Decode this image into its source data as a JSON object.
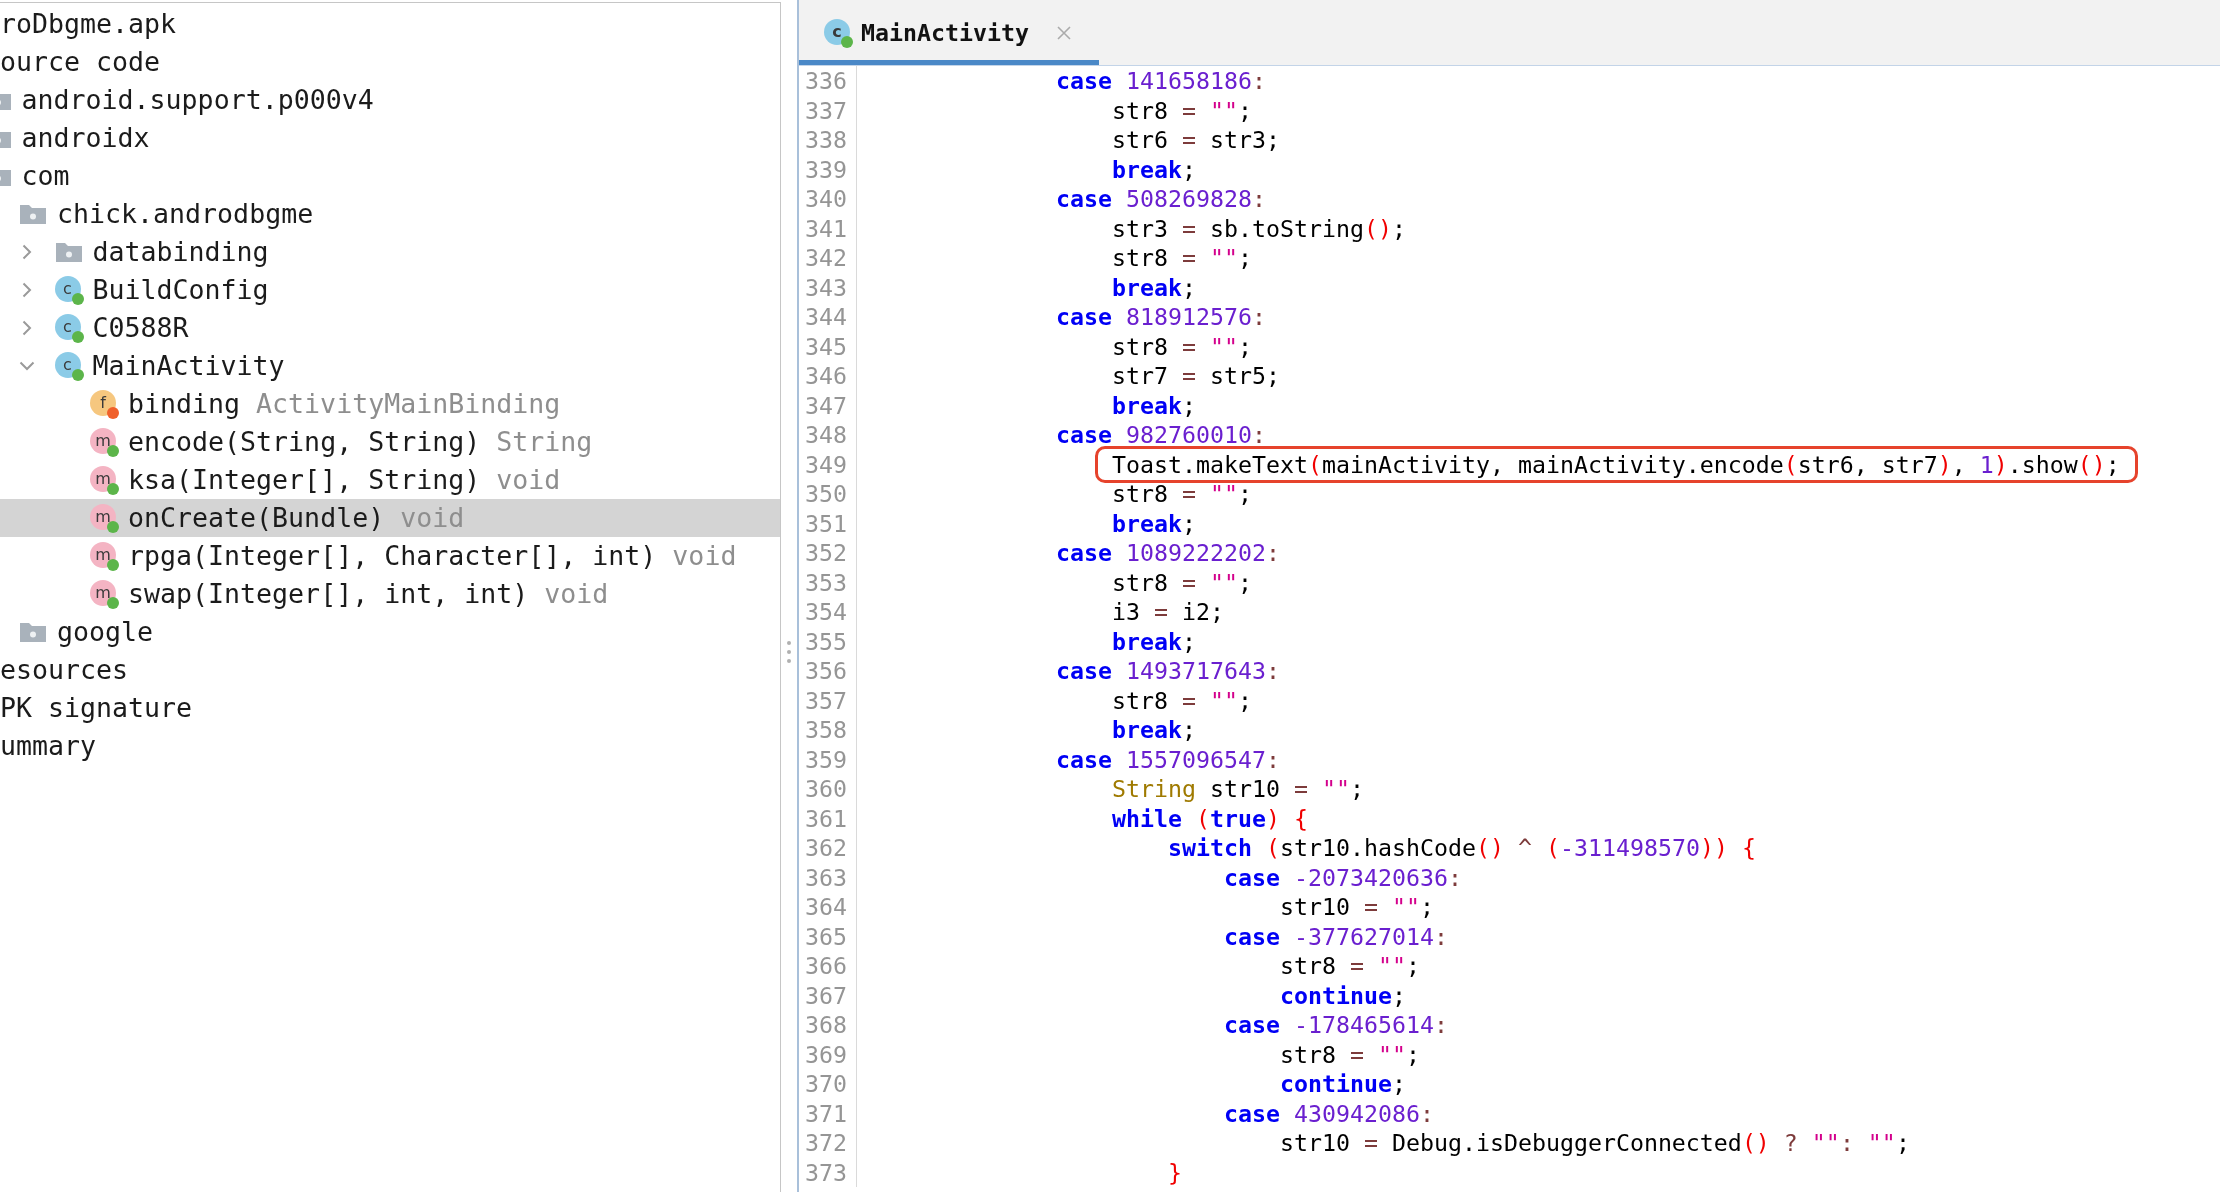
{
  "project_tree": {
    "items": [
      {
        "label": "roDbgme.apk",
        "selected": false,
        "children": [
          {
            "label": "ource code",
            "selected": false,
            "children": [
              {
                "label": "android.support.p000v4",
                "kind": "package",
                "selected": false
              },
              {
                "label": "androidx",
                "kind": "package",
                "selected": false
              },
              {
                "label": "com",
                "kind": "package",
                "selected": false,
                "children": [
                  {
                    "label": "chick.androdbgme",
                    "kind": "package",
                    "selected": false,
                    "children": [
                      {
                        "label": "databinding",
                        "kind": "package",
                        "expanded": false,
                        "selected": false
                      },
                      {
                        "label": "BuildConfig",
                        "kind": "class",
                        "icon_letter": "c",
                        "color": "#5cb54a",
                        "expanded": false,
                        "selected": false
                      },
                      {
                        "label": "C0588R",
                        "kind": "class",
                        "icon_letter": "c",
                        "color": "#5cb54a",
                        "expanded": false,
                        "selected": false
                      },
                      {
                        "label": "MainActivity",
                        "kind": "class",
                        "icon_letter": "c",
                        "color": "#5cb54a",
                        "expanded": true,
                        "selected": false,
                        "children": [
                          {
                            "label": "binding",
                            "type": "ActivityMainBinding",
                            "kind": "field",
                            "icon_letter": "f",
                            "color": "#f0602b",
                            "selected": false
                          },
                          {
                            "label": "encode(String, String)",
                            "type": "String",
                            "kind": "method",
                            "icon_letter": "m",
                            "color": "#5cb54a",
                            "selected": false
                          },
                          {
                            "label": "ksa(Integer[], String)",
                            "type": "void",
                            "kind": "method",
                            "icon_letter": "m",
                            "color": "#5cb54a",
                            "selected": false
                          },
                          {
                            "label": "onCreate(Bundle)",
                            "type": "void",
                            "kind": "method",
                            "icon_letter": "m",
                            "color": "#5cb54a",
                            "selected": true
                          },
                          {
                            "label": "rpga(Integer[], Character[], int)",
                            "type": "void",
                            "kind": "method",
                            "icon_letter": "m",
                            "color": "#5cb54a",
                            "selected": false
                          },
                          {
                            "label": "swap(Integer[], int, int)",
                            "type": "void",
                            "kind": "method",
                            "icon_letter": "m",
                            "color": "#5cb54a",
                            "selected": false
                          }
                        ]
                      }
                    ]
                  },
                  {
                    "label": "google",
                    "kind": "package",
                    "selected": false
                  }
                ]
              }
            ]
          },
          {
            "label": "esources",
            "selected": false
          },
          {
            "label": "PK signature",
            "selected": false
          },
          {
            "label": "ummary",
            "selected": false
          }
        ]
      }
    ]
  },
  "tabs": [
    {
      "label": "MainActivity",
      "icon_letter": "c",
      "color": "#5cb54a",
      "selected": true
    }
  ],
  "code": {
    "lines": [
      {
        "number": "336",
        "tokens": [
          {
            "kind": "keyword",
            "text": "            case"
          },
          {
            "kind": "number",
            "text": " 141658186"
          },
          {
            "kind": "operator",
            "text": ":"
          }
        ]
      },
      {
        "number": "337",
        "tokens": [
          {
            "kind": "plain",
            "text": "                str8 "
          },
          {
            "kind": "operator",
            "text": "="
          },
          {
            "kind": "string",
            "text": " \"\""
          },
          {
            "kind": "plain",
            "text": ";"
          }
        ]
      },
      {
        "number": "338",
        "tokens": [
          {
            "kind": "plain",
            "text": "                str6 "
          },
          {
            "kind": "operator",
            "text": "="
          },
          {
            "kind": "plain",
            "text": " str3;"
          }
        ]
      },
      {
        "number": "339",
        "tokens": [
          {
            "kind": "keyword",
            "text": "                break"
          },
          {
            "kind": "plain",
            "text": ";"
          }
        ]
      },
      {
        "number": "340",
        "tokens": [
          {
            "kind": "keyword",
            "text": "            case"
          },
          {
            "kind": "number",
            "text": " 508269828"
          },
          {
            "kind": "operator",
            "text": ":"
          }
        ]
      },
      {
        "number": "341",
        "tokens": [
          {
            "kind": "plain",
            "text": "                str3 "
          },
          {
            "kind": "operator",
            "text": "="
          },
          {
            "kind": "plain",
            "text": " sb.toString"
          },
          {
            "kind": "bracket",
            "text": "()"
          },
          {
            "kind": "plain",
            "text": ";"
          }
        ]
      },
      {
        "number": "342",
        "tokens": [
          {
            "kind": "plain",
            "text": "                str8 "
          },
          {
            "kind": "operator",
            "text": "="
          },
          {
            "kind": "string",
            "text": " \"\""
          },
          {
            "kind": "plain",
            "text": ";"
          }
        ]
      },
      {
        "number": "343",
        "tokens": [
          {
            "kind": "keyword",
            "text": "                break"
          },
          {
            "kind": "plain",
            "text": ";"
          }
        ]
      },
      {
        "number": "344",
        "tokens": [
          {
            "kind": "keyword",
            "text": "            case"
          },
          {
            "kind": "number",
            "text": " 818912576"
          },
          {
            "kind": "operator",
            "text": ":"
          }
        ]
      },
      {
        "number": "345",
        "tokens": [
          {
            "kind": "plain",
            "text": "                str8 "
          },
          {
            "kind": "operator",
            "text": "="
          },
          {
            "kind": "string",
            "text": " \"\""
          },
          {
            "kind": "plain",
            "text": ";"
          }
        ]
      },
      {
        "number": "346",
        "tokens": [
          {
            "kind": "plain",
            "text": "                str7 "
          },
          {
            "kind": "operator",
            "text": "="
          },
          {
            "kind": "plain",
            "text": " str5;"
          }
        ]
      },
      {
        "number": "347",
        "tokens": [
          {
            "kind": "keyword",
            "text": "                break"
          },
          {
            "kind": "plain",
            "text": ";"
          }
        ]
      },
      {
        "number": "348",
        "tokens": [
          {
            "kind": "keyword",
            "text": "            case"
          },
          {
            "kind": "number",
            "text": " 982760010"
          },
          {
            "kind": "operator",
            "text": ":"
          }
        ]
      },
      {
        "number": "349",
        "boxed": true,
        "tokens": [
          {
            "kind": "plain",
            "text": "                Toast.makeText"
          },
          {
            "kind": "bracket",
            "text": "("
          },
          {
            "kind": "plain",
            "text": "mainActivity, mainActivity.encode"
          },
          {
            "kind": "bracket",
            "text": "("
          },
          {
            "kind": "plain",
            "text": "str6, str7"
          },
          {
            "kind": "bracket",
            "text": ")"
          },
          {
            "kind": "plain",
            "text": ", "
          },
          {
            "kind": "number",
            "text": "1"
          },
          {
            "kind": "bracket",
            "text": ")"
          },
          {
            "kind": "plain",
            "text": ".show"
          },
          {
            "kind": "bracket",
            "text": "()"
          },
          {
            "kind": "plain",
            "text": ";"
          }
        ]
      },
      {
        "number": "350",
        "tokens": [
          {
            "kind": "plain",
            "text": "                str8 "
          },
          {
            "kind": "operator",
            "text": "="
          },
          {
            "kind": "string",
            "text": " \"\""
          },
          {
            "kind": "plain",
            "text": ";"
          }
        ]
      },
      {
        "number": "351",
        "tokens": [
          {
            "kind": "keyword",
            "text": "                break"
          },
          {
            "kind": "plain",
            "text": ";"
          }
        ]
      },
      {
        "number": "352",
        "tokens": [
          {
            "kind": "keyword",
            "text": "            case"
          },
          {
            "kind": "number",
            "text": " 1089222202"
          },
          {
            "kind": "operator",
            "text": ":"
          }
        ]
      },
      {
        "number": "353",
        "tokens": [
          {
            "kind": "plain",
            "text": "                str8 "
          },
          {
            "kind": "operator",
            "text": "="
          },
          {
            "kind": "string",
            "text": " \"\""
          },
          {
            "kind": "plain",
            "text": ";"
          }
        ]
      },
      {
        "number": "354",
        "tokens": [
          {
            "kind": "plain",
            "text": "                i3 "
          },
          {
            "kind": "operator",
            "text": "="
          },
          {
            "kind": "plain",
            "text": " i2;"
          }
        ]
      },
      {
        "number": "355",
        "tokens": [
          {
            "kind": "keyword",
            "text": "                break"
          },
          {
            "kind": "plain",
            "text": ";"
          }
        ]
      },
      {
        "number": "356",
        "tokens": [
          {
            "kind": "keyword",
            "text": "            case"
          },
          {
            "kind": "number",
            "text": " 1493717643"
          },
          {
            "kind": "operator",
            "text": ":"
          }
        ]
      },
      {
        "number": "357",
        "tokens": [
          {
            "kind": "plain",
            "text": "                str8 "
          },
          {
            "kind": "operator",
            "text": "="
          },
          {
            "kind": "string",
            "text": " \"\""
          },
          {
            "kind": "plain",
            "text": ";"
          }
        ]
      },
      {
        "number": "358",
        "tokens": [
          {
            "kind": "keyword",
            "text": "                break"
          },
          {
            "kind": "plain",
            "text": ";"
          }
        ]
      },
      {
        "number": "359",
        "tokens": [
          {
            "kind": "keyword",
            "text": "            case"
          },
          {
            "kind": "number",
            "text": " 1557096547"
          },
          {
            "kind": "operator",
            "text": ":"
          }
        ]
      },
      {
        "number": "360",
        "tokens": [
          {
            "kind": "type",
            "text": "                String"
          },
          {
            "kind": "plain",
            "text": " str10 "
          },
          {
            "kind": "operator",
            "text": "="
          },
          {
            "kind": "string",
            "text": " \"\""
          },
          {
            "kind": "plain",
            "text": ";"
          }
        ]
      },
      {
        "number": "361",
        "tokens": [
          {
            "kind": "keyword",
            "text": "                while"
          },
          {
            "kind": "bracket",
            "text": " ("
          },
          {
            "kind": "keyword",
            "text": "true"
          },
          {
            "kind": "bracket",
            "text": ") {"
          }
        ]
      },
      {
        "number": "362",
        "tokens": [
          {
            "kind": "keyword",
            "text": "                    switch"
          },
          {
            "kind": "bracket",
            "text": " ("
          },
          {
            "kind": "plain",
            "text": "str10.hashCode"
          },
          {
            "kind": "bracket",
            "text": "()"
          },
          {
            "kind": "operator",
            "text": " ^"
          },
          {
            "kind": "bracket",
            "text": " ("
          },
          {
            "kind": "number",
            "text": "-311498570"
          },
          {
            "kind": "bracket",
            "text": ")) {"
          }
        ]
      },
      {
        "number": "363",
        "tokens": [
          {
            "kind": "keyword",
            "text": "                        case"
          },
          {
            "kind": "number",
            "text": " -2073420636"
          },
          {
            "kind": "operator",
            "text": ":"
          }
        ]
      },
      {
        "number": "364",
        "tokens": [
          {
            "kind": "plain",
            "text": "                            str10 "
          },
          {
            "kind": "operator",
            "text": "="
          },
          {
            "kind": "string",
            "text": " \"\""
          },
          {
            "kind": "plain",
            "text": ";"
          }
        ]
      },
      {
        "number": "365",
        "tokens": [
          {
            "kind": "keyword",
            "text": "                        case"
          },
          {
            "kind": "number",
            "text": " -377627014"
          },
          {
            "kind": "operator",
            "text": ":"
          }
        ]
      },
      {
        "number": "366",
        "tokens": [
          {
            "kind": "plain",
            "text": "                            str8 "
          },
          {
            "kind": "operator",
            "text": "="
          },
          {
            "kind": "string",
            "text": " \"\""
          },
          {
            "kind": "plain",
            "text": ";"
          }
        ]
      },
      {
        "number": "367",
        "tokens": [
          {
            "kind": "keyword",
            "text": "                            continue"
          },
          {
            "kind": "plain",
            "text": ";"
          }
        ]
      },
      {
        "number": "368",
        "tokens": [
          {
            "kind": "keyword",
            "text": "                        case"
          },
          {
            "kind": "number",
            "text": " -178465614"
          },
          {
            "kind": "operator",
            "text": ":"
          }
        ]
      },
      {
        "number": "369",
        "tokens": [
          {
            "kind": "plain",
            "text": "                            str8 "
          },
          {
            "kind": "operator",
            "text": "="
          },
          {
            "kind": "string",
            "text": " \"\""
          },
          {
            "kind": "plain",
            "text": ";"
          }
        ]
      },
      {
        "number": "370",
        "tokens": [
          {
            "kind": "keyword",
            "text": "                            continue"
          },
          {
            "kind": "plain",
            "text": ";"
          }
        ]
      },
      {
        "number": "371",
        "tokens": [
          {
            "kind": "keyword",
            "text": "                        case"
          },
          {
            "kind": "number",
            "text": " 430942086"
          },
          {
            "kind": "operator",
            "text": ":"
          }
        ]
      },
      {
        "number": "372",
        "tokens": [
          {
            "kind": "plain",
            "text": "                            str10 "
          },
          {
            "kind": "operator",
            "text": "="
          },
          {
            "kind": "plain",
            "text": " Debug.isDebuggerConnected"
          },
          {
            "kind": "bracket",
            "text": "()"
          },
          {
            "kind": "operator",
            "text": " ?"
          },
          {
            "kind": "string",
            "text": " \"\""
          },
          {
            "kind": "operator",
            "text": ":"
          },
          {
            "kind": "string",
            "text": " \"\""
          },
          {
            "kind": "plain",
            "text": ";"
          }
        ]
      },
      {
        "number": "373",
        "tokens": [
          {
            "kind": "bracket",
            "text": "                    }"
          }
        ]
      }
    ]
  }
}
